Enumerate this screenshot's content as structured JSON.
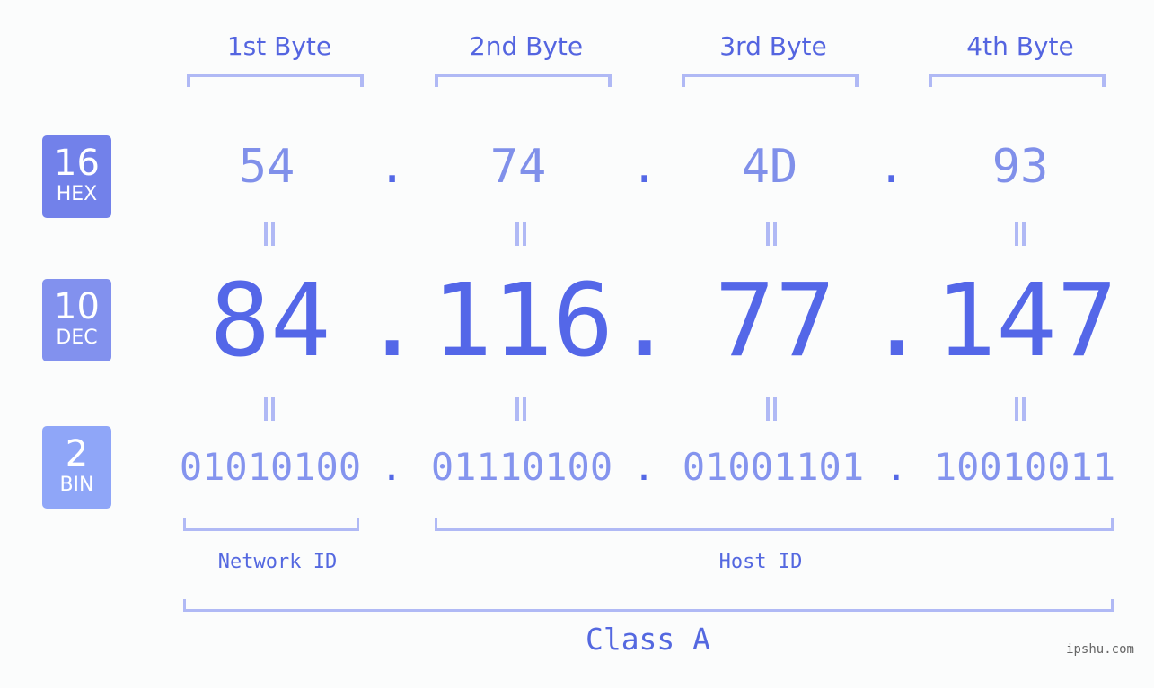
{
  "badges": {
    "hex": {
      "number": "16",
      "label": "HEX",
      "color": "#7281ea"
    },
    "dec": {
      "number": "10",
      "label": "DEC",
      "color": "#8291ee"
    },
    "bin": {
      "number": "2",
      "label": "BIN",
      "color": "#8fa6f8"
    }
  },
  "bytes": [
    {
      "title": "1st Byte",
      "hex": "54",
      "dec": "84",
      "bin": "01010100"
    },
    {
      "title": "2nd Byte",
      "hex": "74",
      "dec": "116",
      "bin": "01110100"
    },
    {
      "title": "3rd Byte",
      "hex": "4D",
      "dec": "77",
      "bin": "01001101"
    },
    {
      "title": "4th Byte",
      "hex": "93",
      "dec": "147",
      "bin": "10010011"
    }
  ],
  "separator": ".",
  "equals_icon": "equals-icon",
  "network_id_label": "Network ID",
  "host_id_label": "Host ID",
  "class_label": "Class A",
  "watermark": "ipshu.com",
  "colors": {
    "accent": "#5467e8",
    "bracket": "#b0b9f5",
    "background": "#fbfcfc"
  }
}
